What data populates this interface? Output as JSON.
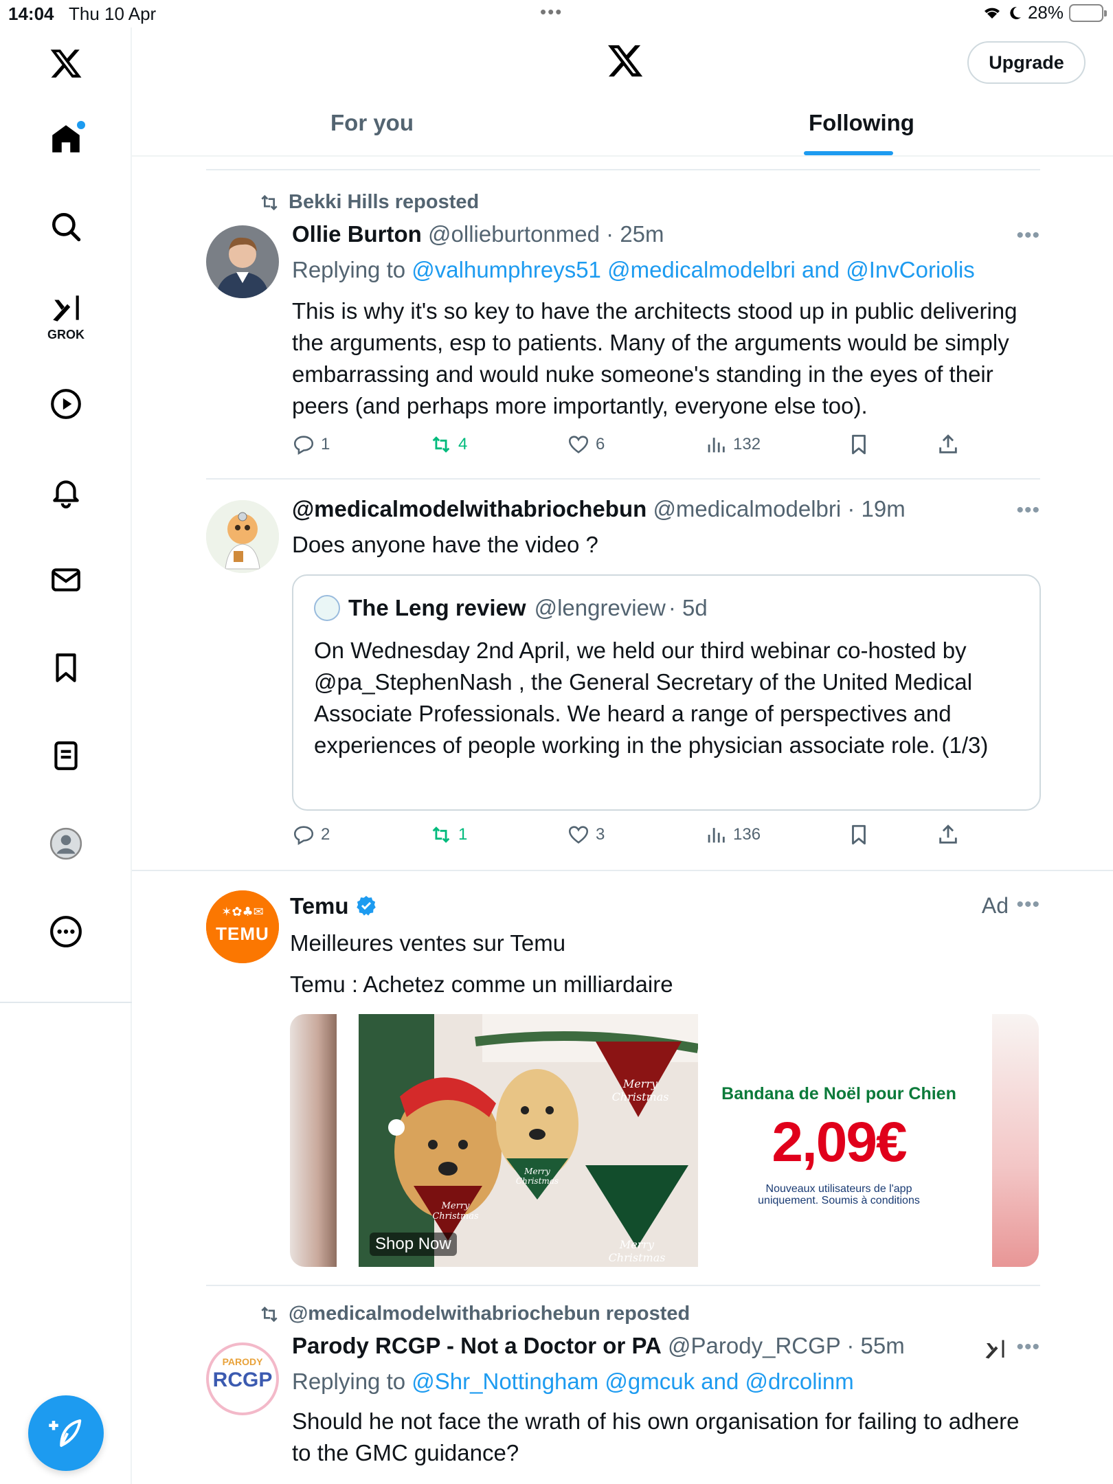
{
  "status_bar": {
    "time": "14:04",
    "date": "Thu 10 Apr",
    "battery": "28%"
  },
  "header": {
    "upgrade_label": "Upgrade",
    "tabs": [
      {
        "label": "For you"
      },
      {
        "label": "Following"
      }
    ]
  },
  "sidebar": {
    "grok_label": "GROK",
    "items": [
      "home-icon",
      "search-icon",
      "grok-icon",
      "video-icon",
      "notifications-icon",
      "messages-icon",
      "bookmarks-icon",
      "lists-icon",
      "profile-icon",
      "more-icon"
    ]
  },
  "posts": [
    {
      "repost_by": "Bekki Hills reposted",
      "name": "Ollie Burton",
      "handle": "@ollieburtonmed",
      "time": "· 25m",
      "reply_prefix": "Replying to",
      "reply_to": "@valhumphreys51 @medicalmodelbri",
      "reply_and": "and",
      "reply_last": "@InvCoriolis",
      "text": "This is why it's so key to have the architects stood up in public delivering the arguments, esp to patients. Many of the arguments would be simply embarrassing and would nuke someone's standing in the eyes of their peers (and perhaps more importantly, everyone else too).",
      "stats": {
        "replies": "1",
        "reposts": "4",
        "likes": "6",
        "views": "132"
      }
    },
    {
      "name": "@medicalmodelwithabriochebun",
      "handle": "@medicalmodelbri",
      "time": "· 19m",
      "text": "Does anyone have the video ?",
      "quote": {
        "name": "The Leng review",
        "handle": "@lengreview",
        "time": "· 5d",
        "text": "On Wednesday 2nd April, we held our third webinar co-hosted by @pa_StephenNash , the General Secretary of the United Medical Associate Professionals. We heard a range of perspectives and experiences of people working in the physician associate role. (1/3)"
      },
      "stats": {
        "replies": "2",
        "reposts": "1",
        "likes": "3",
        "views": "136"
      }
    },
    {
      "name": "Temu",
      "ad_label": "Ad",
      "avatar_text": "TEMU",
      "text1": "Meilleures ventes sur Temu",
      "text2": "Temu : Achetez comme un milliardaire",
      "card": {
        "title": "Bandana de Noël pour Chien",
        "price": "2,09€",
        "note_line1": "Nouveaux utilisateurs de l'app",
        "note_line2": "uniquement. Soumis à conditions",
        "shop_now": "Shop Now",
        "bandana_text": "Merry Christmas"
      }
    },
    {
      "repost_by": "@medicalmodelwithabriochebun reposted",
      "name": "Parody RCGP - Not a Doctor or PA",
      "handle": "@Parody_RCGP",
      "time": "· 55m",
      "avatar_top": "PARODY",
      "avatar_main": "RCGP",
      "reply_prefix": "Replying to",
      "reply_to": "@Shr_Nottingham @gmcuk",
      "reply_and": "and",
      "reply_last": "@drcolinm",
      "text": "Should he not face the wrath of his own organisation for failing to adhere to the GMC guidance?"
    }
  ],
  "colors": {
    "accent": "#1d9bf0",
    "repost_green": "#00ba7c",
    "temu_orange": "#fb7701",
    "ad_price_red": "#e0001b"
  }
}
